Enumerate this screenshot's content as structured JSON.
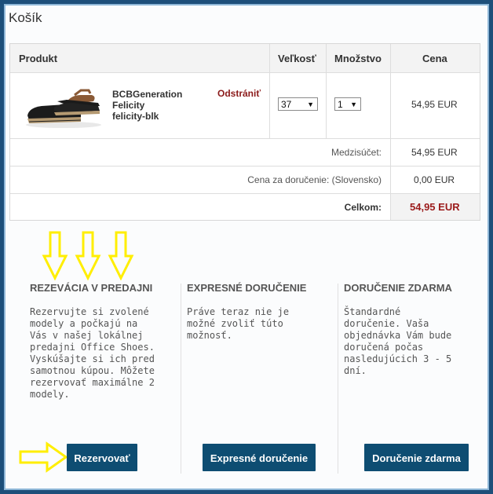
{
  "page": {
    "title": "Košík"
  },
  "cart": {
    "headers": {
      "product": "Produkt",
      "size": "Veľkosť",
      "quantity": "Množstvo",
      "price": "Cena"
    },
    "item": {
      "name": "BCBGeneration",
      "model": "Felicity",
      "sku": "felicity-blk",
      "remove_label": "Odstrániť",
      "size_value": "37",
      "quantity_value": "1",
      "price": "54,95 EUR"
    },
    "subtotal": {
      "label": "Medzisúčet:",
      "value": "54,95 EUR"
    },
    "shipping": {
      "label": "Cena za doručenie: (Slovensko)",
      "value": "0,00 EUR"
    },
    "total": {
      "label": "Celkom:",
      "value": "54,95 EUR"
    }
  },
  "options": [
    {
      "title": "REZEVÁCIA V PREDAJNI",
      "text": "Rezervujte si zvolené modely a počkajú na Vás v našej lokálnej predajni Office Shoes. Vyskúšajte si ich pred samotnou kúpou. Môžete rezervovať maximálne 2 modely.",
      "button": "Rezervovať"
    },
    {
      "title": "EXPRESNÉ DORUČENIE",
      "text": "Práve teraz nie je možné zvoliť túto možnosť.",
      "button": "Expresné doručenie"
    },
    {
      "title": "DORUČENIE ZDARMA",
      "text": "Štandardné doručenie. Vaša objednávka Vám bude doručená počas nasledujúcich 3 - 5 dní.",
      "button": "Doručenie zdarma"
    }
  ],
  "annotation_color": "#ffee00",
  "accent_color": "#0e4d72",
  "price_highlight_color": "#9b1b1b"
}
